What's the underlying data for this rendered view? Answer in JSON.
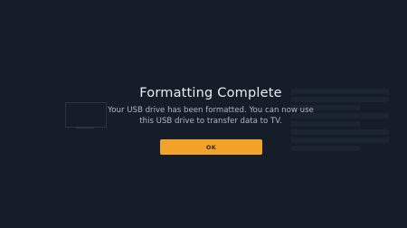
{
  "dialog": {
    "title": "Formatting Complete",
    "message_line1": "Your USB drive has been formatted. You can now use",
    "message_line2": "this USB drive to transfer data to TV.",
    "ok_label": "OK"
  },
  "colors": {
    "background": "#17222c",
    "accent": "#f0a229",
    "title_text": "#e9edf1",
    "message_text": "#aeb7bf"
  }
}
